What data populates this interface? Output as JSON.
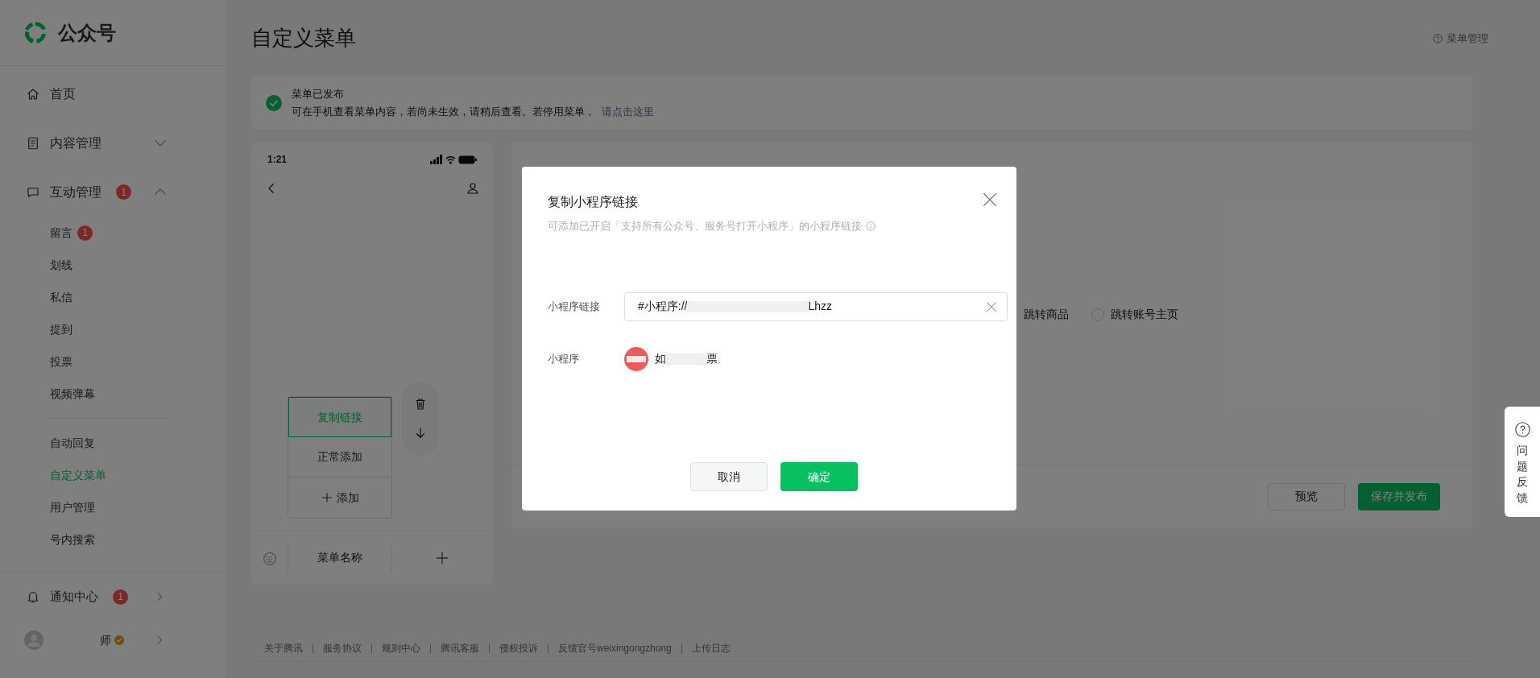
{
  "sidebar": {
    "logo_text": "公众号",
    "items": [
      {
        "label": "首页",
        "selected": false
      },
      {
        "label": "内容管理",
        "expanded": false,
        "selected": false
      },
      {
        "label": "互动管理",
        "badge": "1",
        "expanded": true,
        "selected": false,
        "children": [
          {
            "label": "留言",
            "badge": "1",
            "selected": false
          },
          {
            "label": "划线",
            "selected": false
          },
          {
            "label": "私信",
            "selected": false
          },
          {
            "label": "提到",
            "selected": false
          },
          {
            "label": "投票",
            "selected": false
          },
          {
            "label": "视频弹幕",
            "selected": false
          },
          {
            "label": "自动回复",
            "divider_before": true,
            "selected": false
          },
          {
            "label": "自定义菜单",
            "selected": true
          },
          {
            "label": "用户管理",
            "selected": false
          },
          {
            "label": "号内搜索",
            "selected": false
          }
        ]
      }
    ],
    "notifications": {
      "label": "通知中心",
      "badge": "1"
    },
    "account": {
      "name": "师",
      "verified": true
    }
  },
  "page": {
    "title": "自定义菜单",
    "help_link": "菜单管理"
  },
  "notice": {
    "title": "菜单已发布",
    "text": "可在手机查看菜单内容，若尚未生效，请稍后查看。若停用菜单，",
    "link": "请点击这里"
  },
  "phone": {
    "time": "1:21",
    "submenu": [
      {
        "kind": "item",
        "label": "复制链接",
        "selected": true
      },
      {
        "kind": "item",
        "label": "正常添加",
        "selected": false
      },
      {
        "kind": "add",
        "label": "添加"
      }
    ],
    "menu_bar": {
      "label": "菜单名称"
    }
  },
  "editor": {
    "options": [
      {
        "label": "跳转商品"
      },
      {
        "label": "跳转账号主页",
        "selected": false
      }
    ],
    "buttons": [
      {
        "kind": "secondary",
        "label": "预览"
      },
      {
        "kind": "primary",
        "label": "保存并发布"
      }
    ]
  },
  "dialog": {
    "title": "复制小程序链接",
    "subtitle": "可添加已开启「支持所有公众号、服务号打开小程序」的小程序链接",
    "link_field": {
      "label": "小程序链接",
      "value_start": "#小程序://",
      "value_end": "Lhzz"
    },
    "mini_program": {
      "label": "小程序",
      "name_start": "如",
      "name_end": "票"
    },
    "buttons": [
      {
        "kind": "secondary",
        "label": "取消"
      },
      {
        "kind": "primary",
        "label": "确定"
      }
    ]
  },
  "footer": {
    "links": [
      "关于腾讯",
      "服务协议",
      "规则中心",
      "腾讯客服",
      "侵权投诉",
      "反馈官号weixingongzhong",
      "上传日志"
    ]
  },
  "feedback": {
    "label": "问题反馈"
  }
}
